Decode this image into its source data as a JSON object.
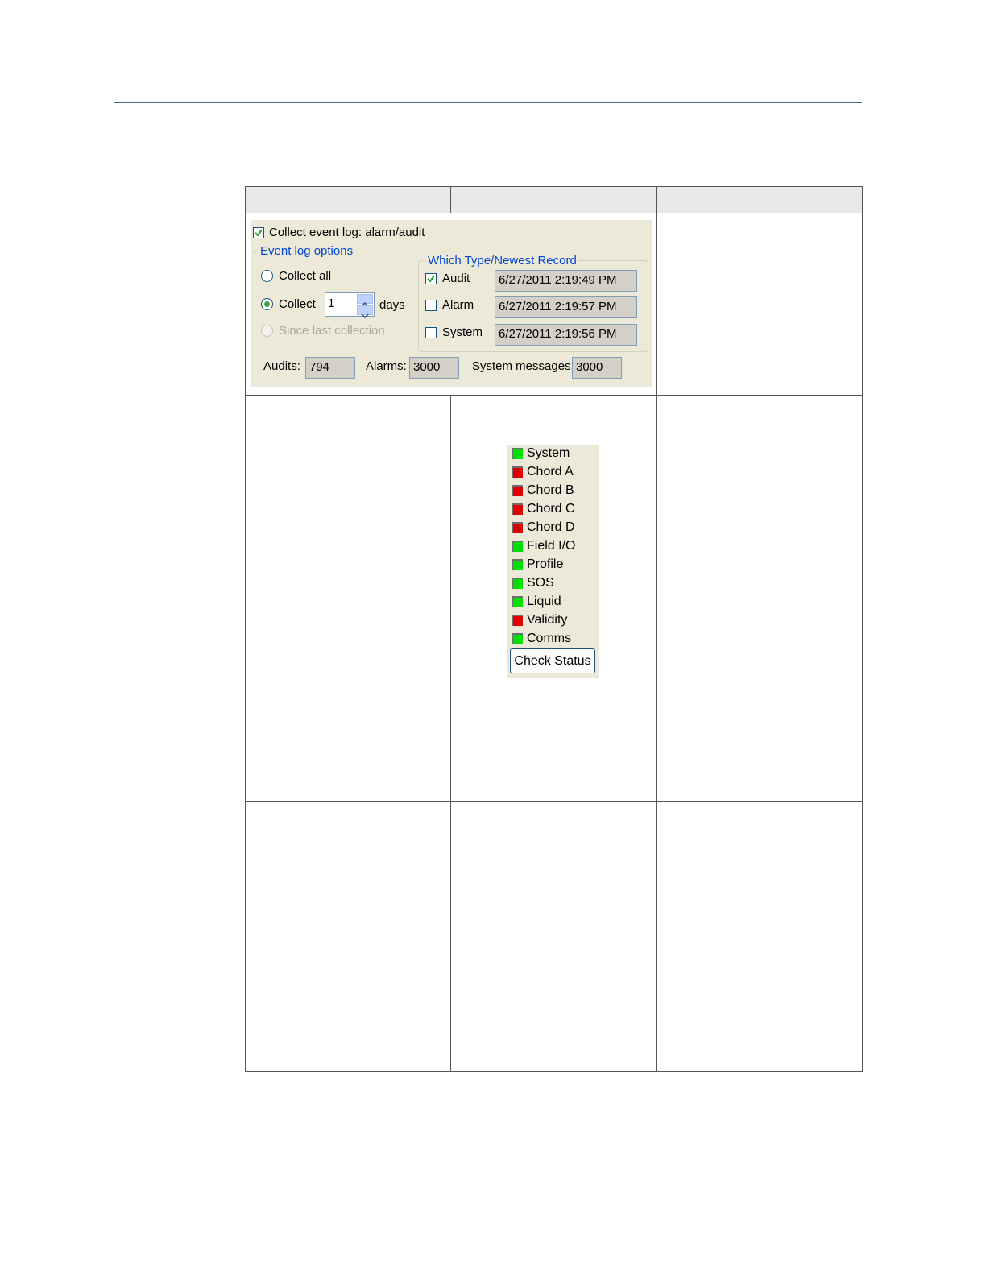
{
  "event_log": {
    "collect_label": "Collect event log: alarm/audit",
    "collect_checked": true,
    "options_legend": "Event log options",
    "collect_all_label": "Collect all",
    "collect_days_label": "Collect",
    "days_value": "1",
    "days_label": "days",
    "since_last_label": "Since last collection",
    "which_type_legend": "Which Type/Newest Record",
    "types": [
      {
        "label": "Audit",
        "checked": true,
        "newest": "6/27/2011 2:19:49 PM"
      },
      {
        "label": "Alarm",
        "checked": false,
        "newest": "6/27/2011 2:19:57 PM"
      },
      {
        "label": "System",
        "checked": false,
        "newest": "6/27/2011 2:19:56 PM"
      }
    ],
    "audits_label": "Audits:",
    "audits_value": "794",
    "alarms_label": "Alarms:",
    "alarms_value": "3000",
    "system_messages_label": "System messages:",
    "system_messages_value": "3000"
  },
  "status_panel": {
    "items": [
      {
        "label": "System",
        "status": "green"
      },
      {
        "label": "Chord A",
        "status": "red"
      },
      {
        "label": "Chord B",
        "status": "red"
      },
      {
        "label": "Chord C",
        "status": "red"
      },
      {
        "label": "Chord D",
        "status": "red"
      },
      {
        "label": "Field I/O",
        "status": "green"
      },
      {
        "label": "Profile",
        "status": "green"
      },
      {
        "label": "SOS",
        "status": "green"
      },
      {
        "label": "Liquid",
        "status": "green"
      },
      {
        "label": "Validity",
        "status": "red"
      },
      {
        "label": "Comms",
        "status": "green"
      }
    ],
    "check_button": "Check Status"
  },
  "colors": {
    "green": "#00e000",
    "red": "#e00000",
    "legend_blue": "#0046d5",
    "panel_bg": "#ece9d8"
  }
}
